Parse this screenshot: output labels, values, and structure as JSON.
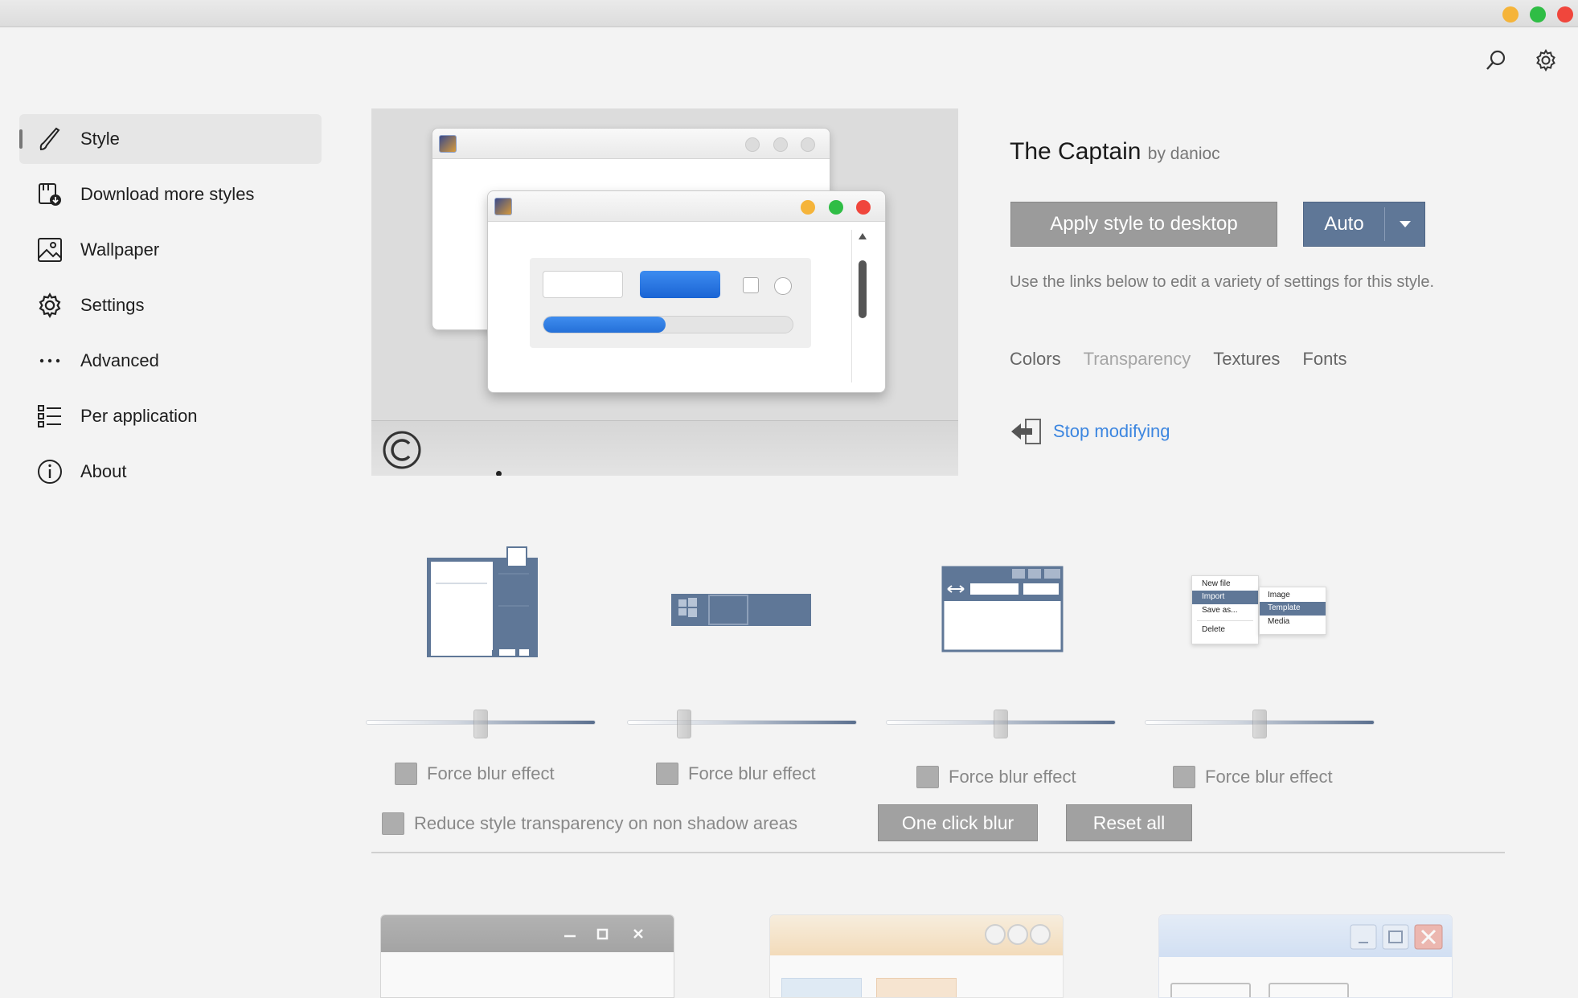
{
  "nav": {
    "items": [
      {
        "label": "Style"
      },
      {
        "label": "Download more styles"
      },
      {
        "label": "Wallpaper"
      },
      {
        "label": "Settings"
      },
      {
        "label": "Advanced"
      },
      {
        "label": "Per application"
      },
      {
        "label": "About"
      }
    ]
  },
  "style": {
    "name": "The Captain",
    "author": "by danioc",
    "apply_label": "Apply style to desktop",
    "mode_label": "Auto",
    "description": "Use the links below to edit a variety of settings for this style.",
    "links": [
      "Colors",
      "Transparency",
      "Textures",
      "Fonts"
    ],
    "stop_label": "Stop modifying"
  },
  "transparency": {
    "targets": [
      {
        "name": "window-frame",
        "force_blur_label": "Force blur effect",
        "level": 0.5
      },
      {
        "name": "taskbar",
        "force_blur_label": "Force blur effect",
        "level": 0.23
      },
      {
        "name": "explorer-bars",
        "force_blur_label": "Force blur effect",
        "level": 0.5
      },
      {
        "name": "menus",
        "force_blur_label": "Force blur effect",
        "level": 0.5
      }
    ],
    "menu_preview": {
      "primary": [
        "New file",
        "Import",
        "Save as...",
        "Delete"
      ],
      "secondary": [
        "Image",
        "Template",
        "Media"
      ]
    },
    "reduce_label": "Reduce style transparency on non shadow areas",
    "one_click_label": "One click blur",
    "reset_label": "Reset all"
  },
  "colors": {
    "accent": "#5f7797",
    "link": "#3c86e0",
    "button_gray": "#9b9b9b"
  }
}
